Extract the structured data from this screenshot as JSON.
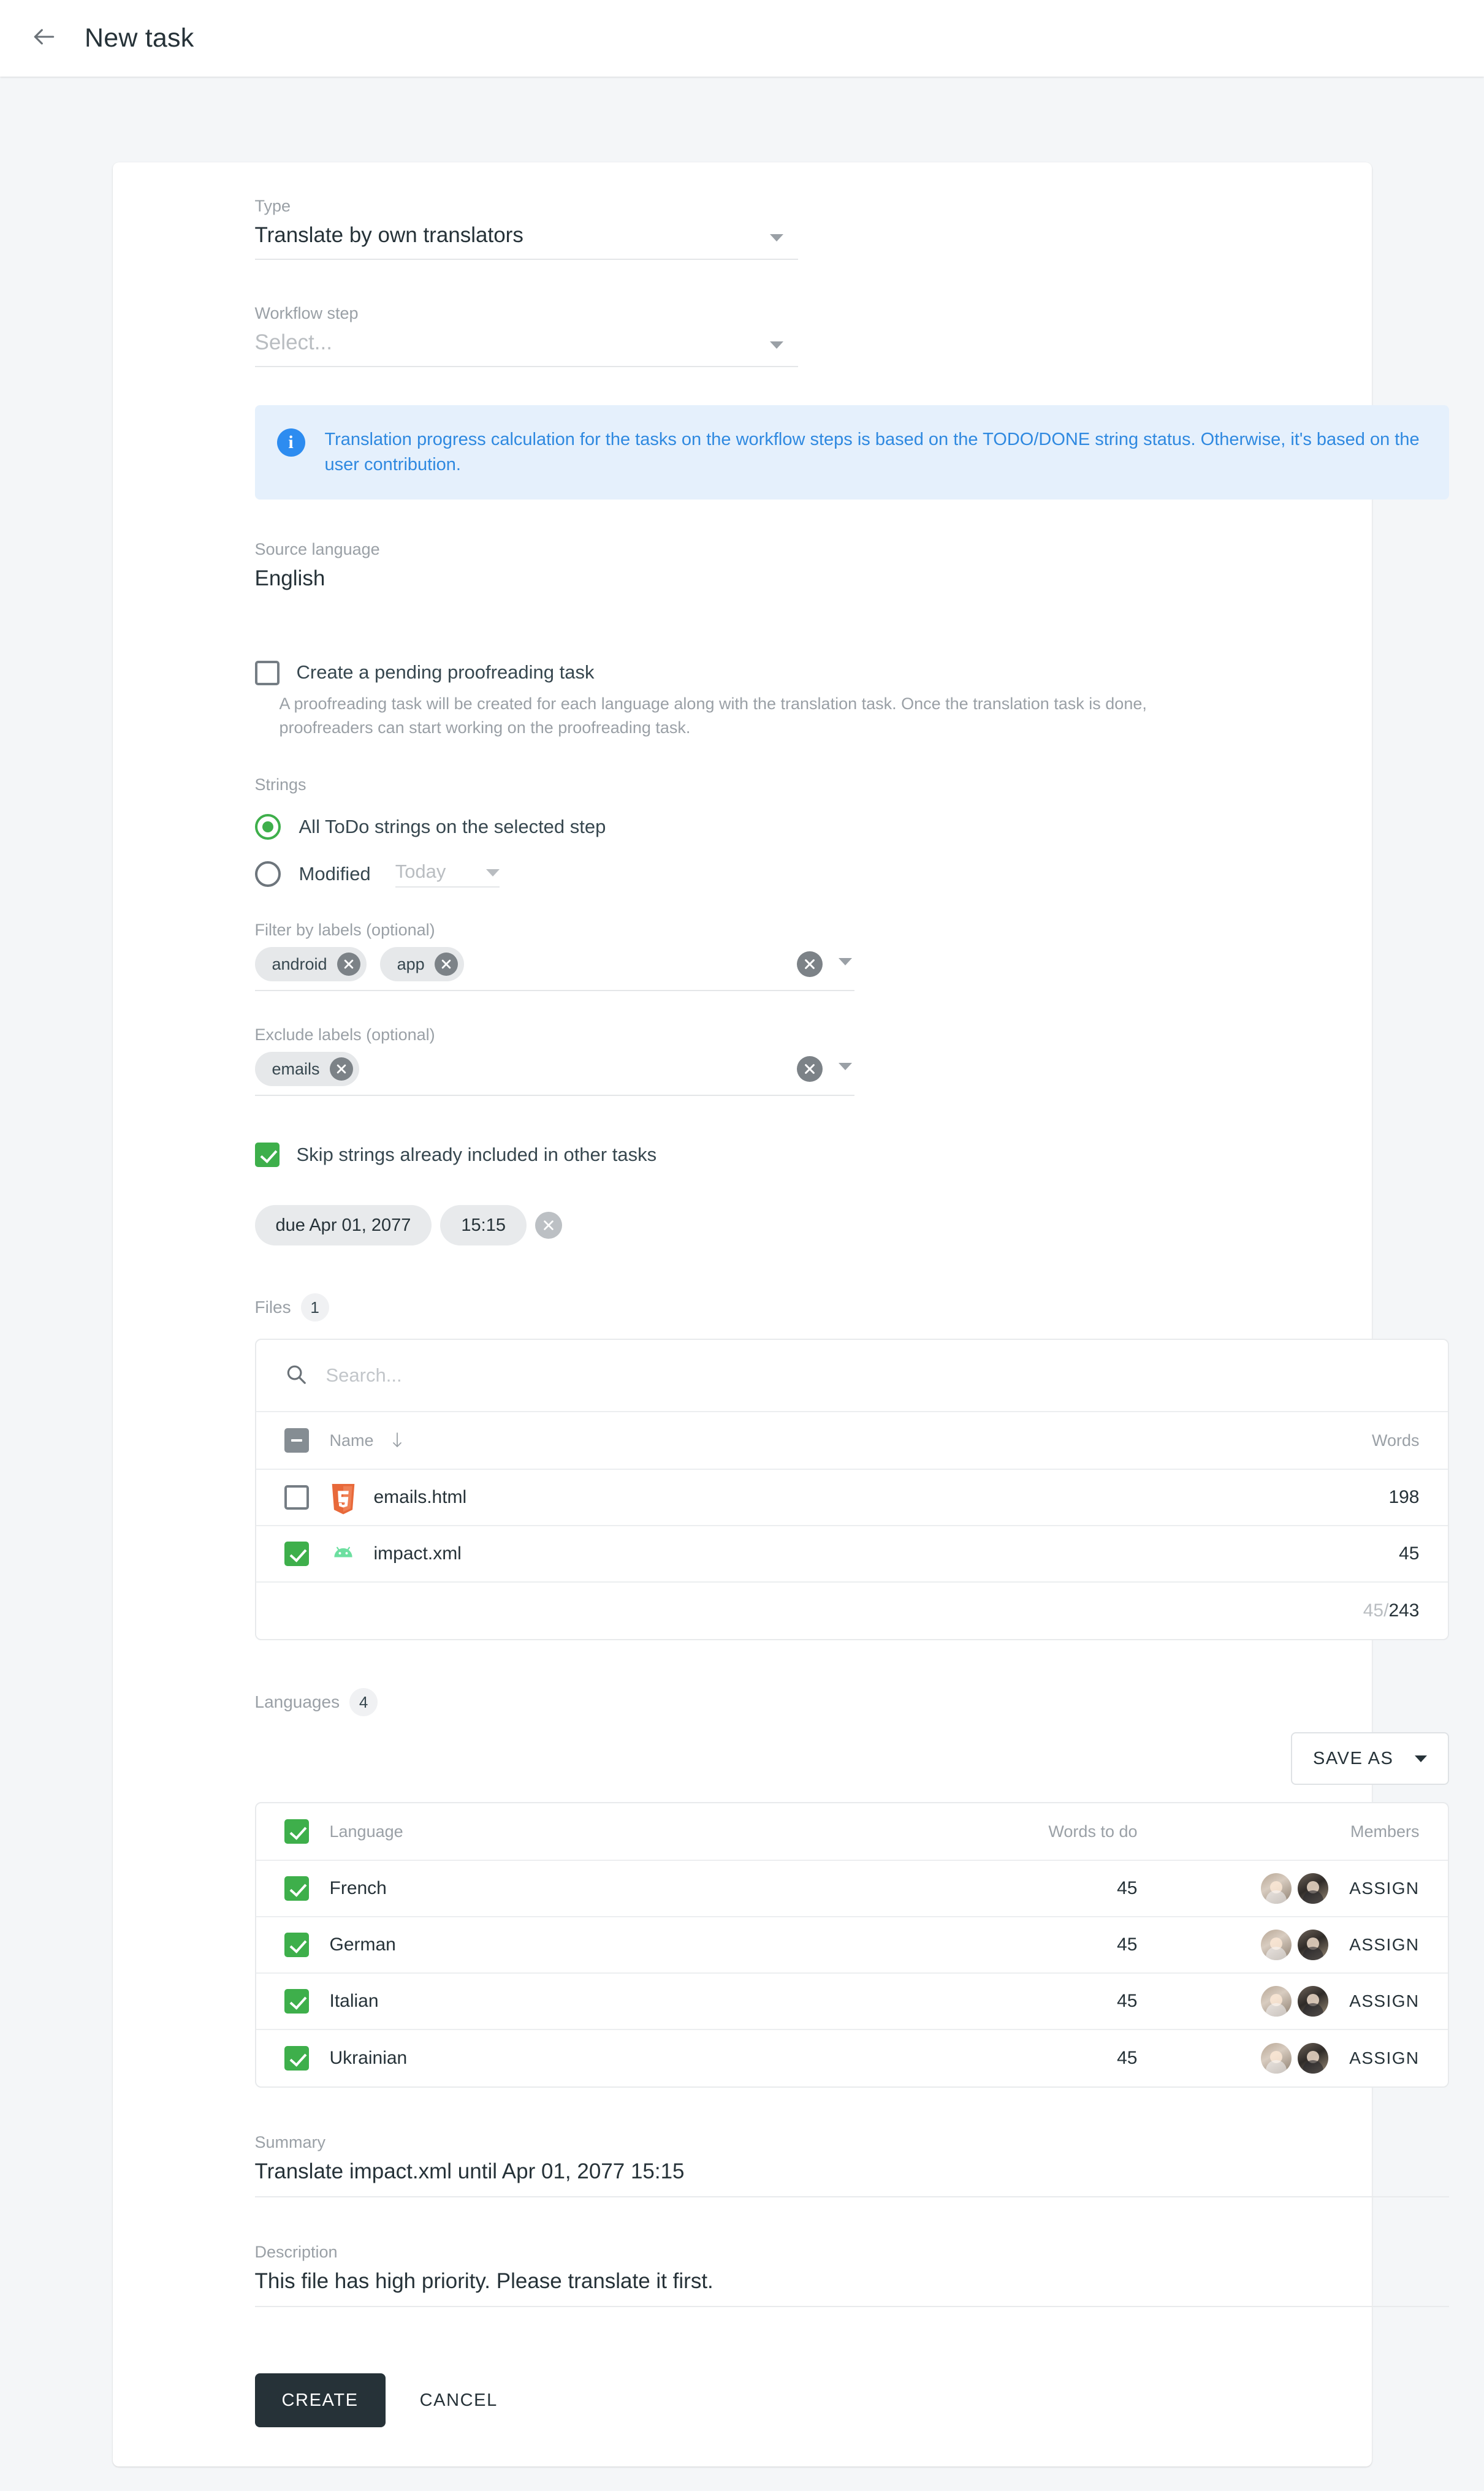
{
  "header": {
    "back_icon": "arrow-left-icon",
    "title": "New task"
  },
  "form": {
    "type": {
      "label": "Type",
      "value": "Translate by own translators"
    },
    "workflow_step": {
      "label": "Workflow step",
      "placeholder": "Select..."
    },
    "info_banner": {
      "icon": "info-icon",
      "text": "Translation progress calculation for the tasks on the workflow steps is based on the TODO/DONE string status. Otherwise, it's based on the user contribution."
    },
    "source_language": {
      "label": "Source language",
      "value": "English"
    },
    "proofreading": {
      "checked": false,
      "label": "Create a pending proofreading task",
      "help": "A proofreading task will be created for each language along with the translation task. Once the translation task is done, proofreaders can start working on the proofreading task."
    },
    "strings": {
      "label": "Strings",
      "options": [
        {
          "label": "All ToDo strings on the selected step",
          "selected": true
        },
        {
          "label": "Modified",
          "selected": false
        }
      ],
      "modified_period": "Today"
    },
    "filter_labels": {
      "label": "Filter by labels (optional)",
      "chips": [
        "android",
        "app"
      ]
    },
    "exclude_labels": {
      "label": "Exclude labels (optional)",
      "chips": [
        "emails"
      ]
    },
    "skip_strings": {
      "checked": true,
      "label": "Skip strings already included in other tasks"
    },
    "due": {
      "date": "due Apr 01, 2077",
      "time": "15:15"
    }
  },
  "files": {
    "label": "Files",
    "count": "1",
    "search_placeholder": "Search...",
    "search_value": "",
    "columns": {
      "name": "Name",
      "words": "Words"
    },
    "header_checkbox_state": "indeterminate",
    "sort_direction": "down",
    "rows": [
      {
        "checked": false,
        "icon": "html5-file-icon",
        "name": "emails.html",
        "words": "198"
      },
      {
        "checked": true,
        "icon": "android-xml-file-icon",
        "name": "impact.xml",
        "words": "45"
      }
    ],
    "total_selected": "45",
    "total_separator": "/",
    "total_all": "243"
  },
  "languages": {
    "label": "Languages",
    "count": "4",
    "save_as_label": "SAVE AS",
    "columns": {
      "language": "Language",
      "words_to_do": "Words to do",
      "members": "Members"
    },
    "header_checked": true,
    "rows": [
      {
        "checked": true,
        "language": "French",
        "words_to_do": "45",
        "assign_label": "ASSIGN",
        "avatars": 2
      },
      {
        "checked": true,
        "language": "German",
        "words_to_do": "45",
        "assign_label": "ASSIGN",
        "avatars": 2
      },
      {
        "checked": true,
        "language": "Italian",
        "words_to_do": "45",
        "assign_label": "ASSIGN",
        "avatars": 2
      },
      {
        "checked": true,
        "language": "Ukrainian",
        "words_to_do": "45",
        "assign_label": "ASSIGN",
        "avatars": 2
      }
    ]
  },
  "summary": {
    "label": "Summary",
    "value": "Translate impact.xml until Apr 01, 2077 15:15"
  },
  "description": {
    "label": "Description",
    "value": "This file has high priority. Please translate it first."
  },
  "footer": {
    "create_label": "CREATE",
    "cancel_label": "CANCEL"
  },
  "colors": {
    "accent_green": "#3eaf4b",
    "info_blue": "#2f89e0",
    "info_bg": "#e5f0fc",
    "dark": "#263238",
    "page_bg": "#f4f6f8"
  }
}
